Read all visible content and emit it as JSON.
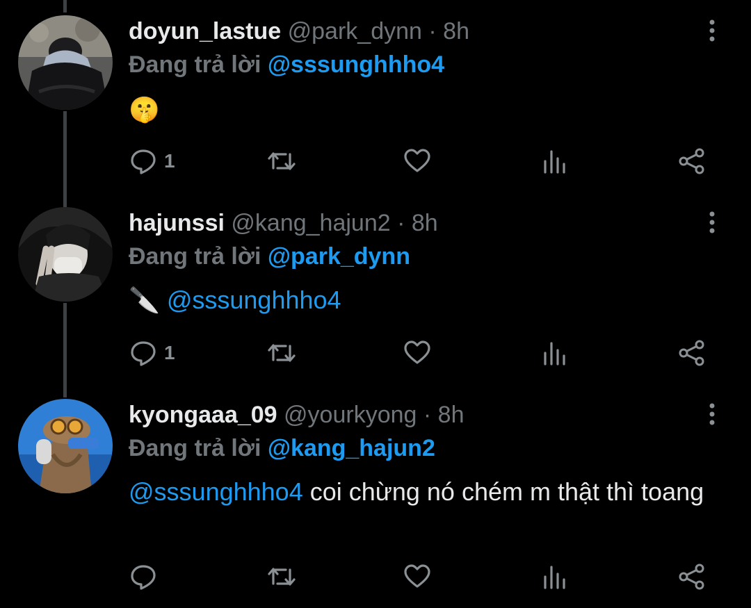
{
  "tweets": [
    {
      "username": "doyun_lastue",
      "handle": "@park_dynn",
      "separator": "·",
      "time": "8h",
      "replying_prefix": "Đang trả lời",
      "replying_to": "@sssunghhho4",
      "body_emoji": "🤫",
      "body_mention": "",
      "body_text": "",
      "reply_count": "1",
      "avatar_icon": "person-in-dark-puffer-avatar"
    },
    {
      "username": "hajunssi",
      "handle": "@kang_hajun2",
      "separator": "·",
      "time": "8h",
      "replying_prefix": "Đang trả lời",
      "replying_to": "@park_dynn",
      "body_emoji": "🔪",
      "body_mention": "@sssunghhho4",
      "body_text": "",
      "reply_count": "1",
      "avatar_icon": "peace-sign-selfie-avatar"
    },
    {
      "username": "kyongaaa_09",
      "handle": "@yourkyong",
      "separator": "·",
      "time": "8h",
      "replying_prefix": "Đang trả lời",
      "replying_to": "@kang_hajun2",
      "body_emoji": "",
      "body_mention": "@sssunghhho4",
      "body_text": " coi chừng nó chém m thật thì toang",
      "reply_count": "",
      "avatar_icon": "aviator-goggles-avatar"
    }
  ],
  "colors": {
    "background": "#000000",
    "text": "#e7e9ea",
    "muted": "#71767b",
    "accent": "#1d9bf0",
    "thread_line": "#3e4144"
  },
  "icons": {
    "reply": "reply-icon",
    "retweet": "retweet-icon",
    "like": "heart-icon",
    "analytics": "analytics-icon",
    "share": "share-icon",
    "more": "more-vertical-icon"
  }
}
